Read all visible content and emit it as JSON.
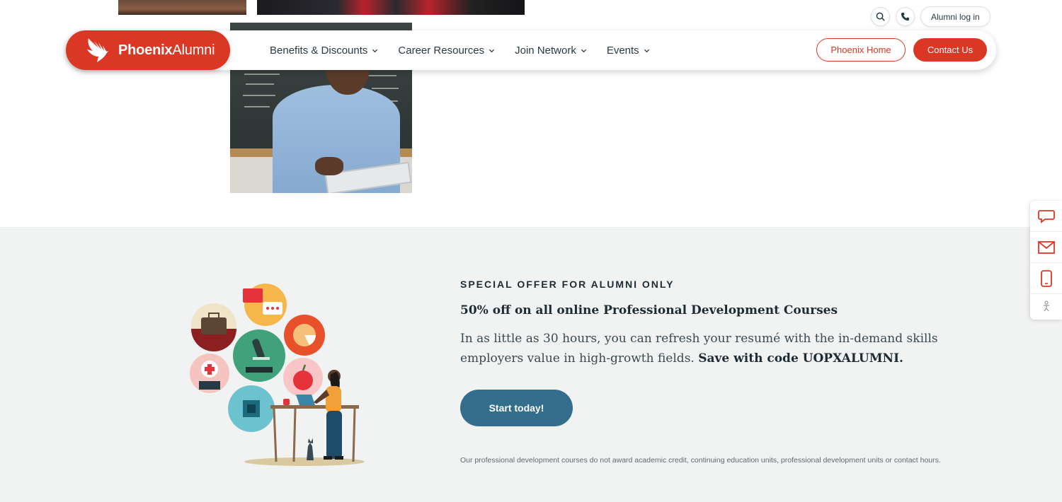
{
  "utility": {
    "alumni_login": "Alumni log in"
  },
  "brand": {
    "name_bold": "Phoenix",
    "name_regular": "Alumni",
    "color": "#db3725"
  },
  "nav": {
    "items": [
      {
        "label": "Benefits & Discounts"
      },
      {
        "label": "Career Resources"
      },
      {
        "label": "Join Network"
      },
      {
        "label": "Events"
      }
    ],
    "phoenix_home": "Phoenix Home",
    "contact_us": "Contact Us"
  },
  "promo": {
    "eyebrow": "SPECIAL OFFER FOR ALUMNI ONLY",
    "headline": "50% off on all online Professional Development Courses",
    "body": "In as little as 30 hours, you can refresh your resumé with the in-demand skills employers value in high-growth fields.",
    "body_bold": "Save with code UOPXALUMNI.",
    "cta": "Start today!",
    "cta_color": "#336f8c",
    "disclaimer": "Our professional development courses do not award academic credit, continuing education units, professional development units or contact hours."
  },
  "side_widget": {
    "icons": [
      "chat-icon",
      "mail-icon",
      "phone-icon",
      "accessibility-icon"
    ]
  }
}
